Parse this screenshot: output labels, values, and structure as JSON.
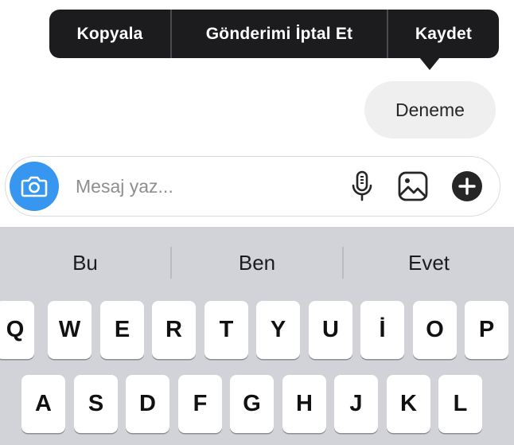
{
  "context_menu": {
    "copy": "Kopyala",
    "unsend": "Gönderimi İptal Et",
    "save": "Kaydet"
  },
  "message": {
    "text": "Deneme"
  },
  "composer": {
    "placeholder": "Mesaj yaz...",
    "camera_icon": "camera-icon",
    "mic_icon": "microphone-icon",
    "gallery_icon": "image-icon",
    "plus_icon": "plus-circle-icon",
    "accent_color": "#3797f0"
  },
  "keyboard": {
    "suggestions": [
      "Bu",
      "Ben",
      "Evet"
    ],
    "row1": [
      "Q",
      "W",
      "E",
      "R",
      "T",
      "Y",
      "U",
      "İ",
      "O",
      "P"
    ],
    "row2": [
      "A",
      "S",
      "D",
      "F",
      "G",
      "H",
      "J",
      "K",
      "L"
    ]
  }
}
